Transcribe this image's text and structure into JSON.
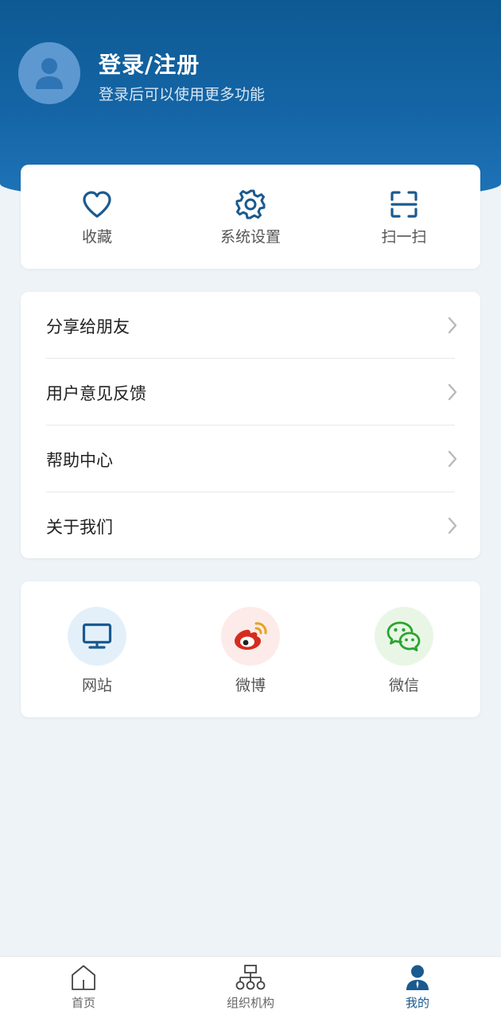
{
  "header": {
    "title": "登录/注册",
    "subtitle": "登录后可以使用更多功能"
  },
  "quick_actions": [
    {
      "label": "收藏",
      "icon": "heart-icon"
    },
    {
      "label": "系统设置",
      "icon": "gear-icon"
    },
    {
      "label": "扫一扫",
      "icon": "scan-icon"
    }
  ],
  "menu": [
    {
      "label": "分享给朋友"
    },
    {
      "label": "用户意见反馈"
    },
    {
      "label": "帮助中心"
    },
    {
      "label": "关于我们"
    }
  ],
  "social": [
    {
      "label": "网站",
      "icon": "monitor-icon"
    },
    {
      "label": "微博",
      "icon": "weibo-icon"
    },
    {
      "label": "微信",
      "icon": "wechat-icon"
    }
  ],
  "tabs": [
    {
      "label": "首页",
      "icon": "home-icon"
    },
    {
      "label": "组织机构",
      "icon": "org-chart-icon"
    },
    {
      "label": "我的",
      "icon": "user-icon",
      "active": true
    }
  ],
  "colors": {
    "brand_blue": "#1565a6",
    "icon_blue": "#1a5a8f",
    "weibo_red": "#d52c1f",
    "wechat_green": "#2aa52e"
  }
}
